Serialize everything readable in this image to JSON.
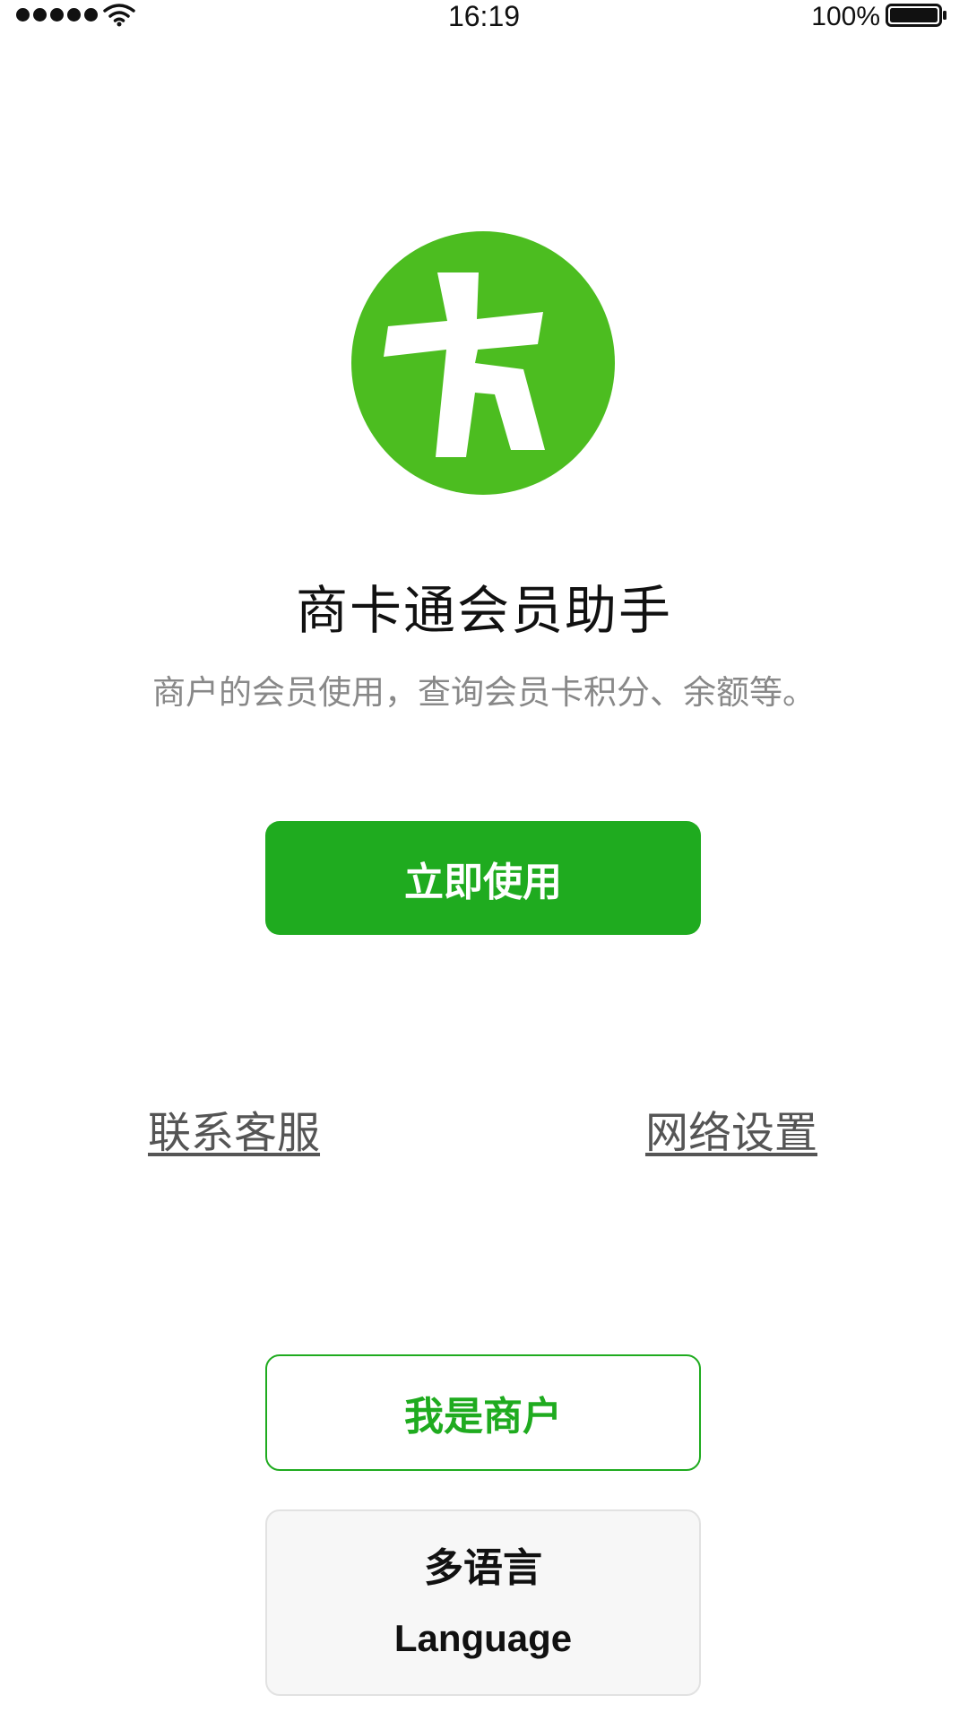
{
  "status_bar": {
    "time": "16:19",
    "battery_percent": "100%",
    "signal_bars": 5,
    "signal_icon": "signal-dots-icon",
    "wifi_icon": "wifi-icon",
    "battery_icon": "battery-full-icon"
  },
  "app": {
    "logo_icon": "card-logo-icon",
    "logo_glyph": "卡",
    "brand_color": "#4cbd20",
    "title": "商卡通会员助手",
    "subtitle": "商户的会员使用，查询会员卡积分、余额等。"
  },
  "actions": {
    "primary_label": "立即使用",
    "primary_color": "#1fab1f",
    "contact_label": "联系客服",
    "network_label": "网络设置",
    "merchant_label": "我是商户",
    "language_zh": "多语言",
    "language_en": "Language"
  }
}
